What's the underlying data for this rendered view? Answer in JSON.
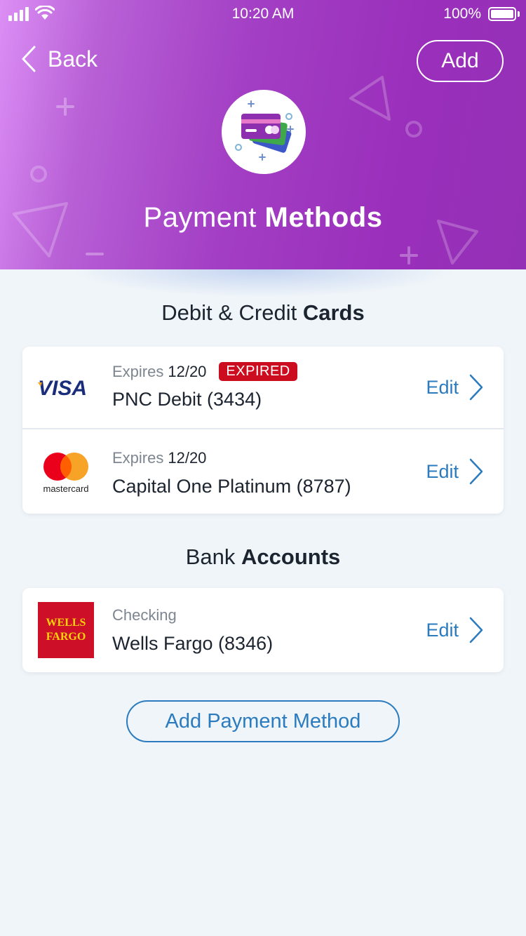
{
  "status_bar": {
    "time": "10:20 AM",
    "battery": "100%"
  },
  "header": {
    "back_label": "Back",
    "add_label": "Add",
    "title_light": "Payment",
    "title_bold": "Methods",
    "hero_icon": "credit-cards-icon"
  },
  "cards_section": {
    "title_light": "Debit & Credit",
    "title_bold": "Cards",
    "items": [
      {
        "brand": "VISA",
        "sub_label": "Expires",
        "date": "12/20",
        "badge": "EXPIRED",
        "name": "PNC Debit  (3434)",
        "action": "Edit"
      },
      {
        "brand": "mastercard",
        "sub_label": "Expires",
        "date": "12/20",
        "badge": "",
        "name": "Capital One Platinum (8787)",
        "action": "Edit"
      }
    ]
  },
  "bank_section": {
    "title_light": "Bank",
    "title_bold": "Accounts",
    "items": [
      {
        "brand_line1": "WELLS",
        "brand_line2": "FARGO",
        "sub_label": "Checking",
        "name": "Wells Fargo  (8346)",
        "action": "Edit"
      }
    ]
  },
  "footer": {
    "add_method_label": "Add Payment Method"
  },
  "colors": {
    "accent": "#2b7bbf",
    "header_gradient_start": "#dc8ff5",
    "header_gradient_end": "#9430b6",
    "expired_badge": "#cc0c1f"
  }
}
